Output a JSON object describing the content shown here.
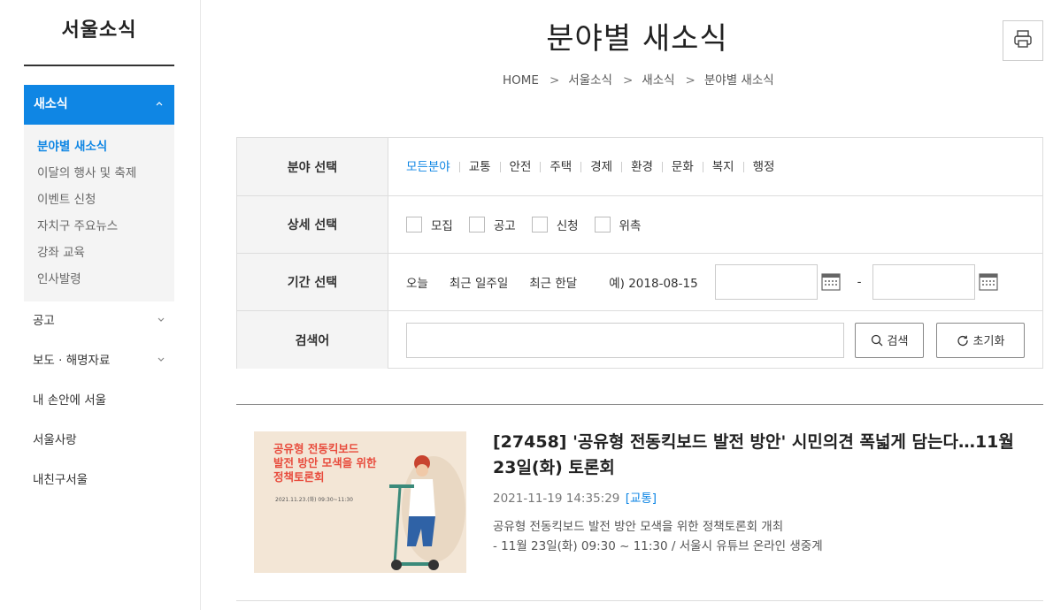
{
  "sidebar": {
    "title": "서울소식",
    "active_menu": {
      "label": "새소식",
      "chevron": "^"
    },
    "submenu": [
      "분야별 새소식",
      "이달의 행사 및 축제",
      "이벤트 신청",
      "자치구 주요뉴스",
      "강좌 교육",
      "인사발령"
    ],
    "menu": [
      {
        "label": "공고",
        "chevron": "v"
      },
      {
        "label": "보도 · 해명자료",
        "chevron": "v"
      },
      {
        "label": "내 손안에 서울"
      },
      {
        "label": "서울사랑"
      },
      {
        "label": "내친구서울"
      }
    ]
  },
  "header": {
    "title": "분야별 새소식",
    "print_icon": "printer-icon",
    "breadcrumb": [
      "HOME",
      "서울소식",
      "새소식",
      "분야별 새소식"
    ]
  },
  "filter": {
    "field_label": "분야 선택",
    "categories": [
      "모든분야",
      "교통",
      "안전",
      "주택",
      "경제",
      "환경",
      "문화",
      "복지",
      "행정"
    ],
    "selected_category": "모든분야",
    "detail_label": "상세 선택",
    "details": [
      "모집",
      "공고",
      "신청",
      "위촉"
    ],
    "period_label": "기간 선택",
    "periods": [
      "오늘",
      "최근 일주일",
      "최근 한달"
    ],
    "date_example": "예) 2018-08-15",
    "date_separator": "-",
    "keyword_label": "검색어",
    "search_button": "검색",
    "reset_button": "초기화"
  },
  "article": {
    "title": "[27458] '공유형 전동킥보드 발전 방안' 시민의견 폭넓게 담는다…11월 23일(화) 토론회",
    "date": "2021-11-19 14:35:29",
    "tag": "[교통]",
    "desc_line1": "공유형 전동킥보드 발전 방안 모색을 위한 정책토론회 개최",
    "desc_line2": "- 11월 23일(화) 09:30 ~ 11:30 / 서울시 유튜브 온라인 생중계",
    "thumb": {
      "line1": "공유형 전동킥보드",
      "line2": "발전 방안 모색을 위한",
      "line3": "정책토론회",
      "when": "2021.11.23.(화) 09:30~11:30"
    }
  },
  "colors": {
    "accent": "#0f86e4",
    "submenu_bg": "#f4f4f4",
    "thumb_red": "#e84b3c"
  }
}
